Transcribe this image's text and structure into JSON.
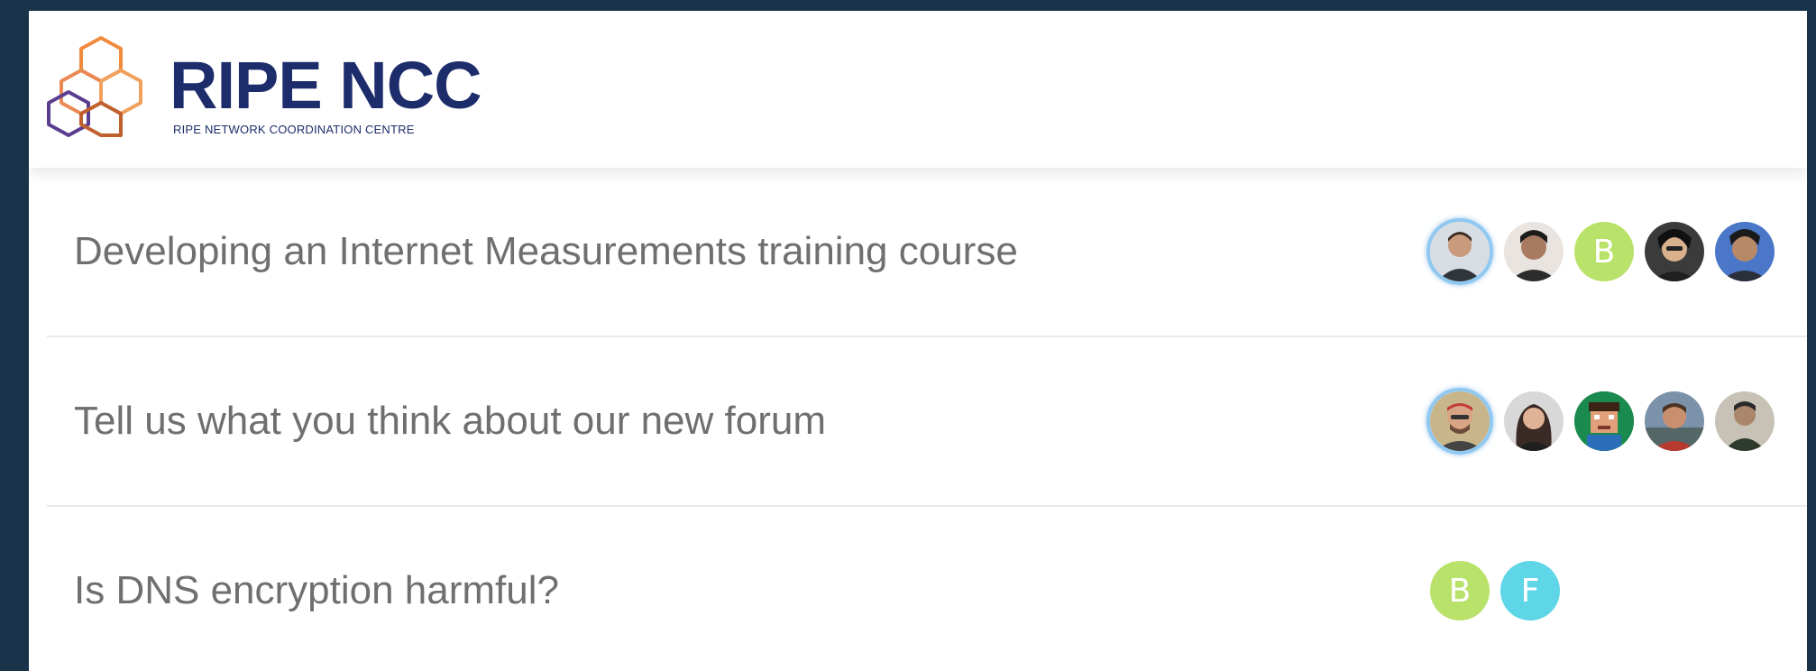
{
  "brand": {
    "name": "RIPE NCC",
    "subtitle": "RIPE NETWORK COORDINATION CENTRE",
    "colors": {
      "navy": "#1d2c6b",
      "orange": "#f08a3c",
      "purple": "#5b3d8f"
    }
  },
  "topics": [
    {
      "title": "Developing an Internet Measurements training course",
      "participants": [
        {
          "icon": "user-avatar",
          "letter": ""
        },
        {
          "icon": "user-avatar",
          "letter": ""
        },
        {
          "icon": "letter-avatar",
          "letter": "B",
          "color": "#b9e26a"
        },
        {
          "icon": "user-avatar",
          "letter": ""
        },
        {
          "icon": "user-avatar",
          "letter": ""
        }
      ]
    },
    {
      "title": "Tell us what you think about our new forum",
      "participants": [
        {
          "icon": "user-avatar",
          "letter": ""
        },
        {
          "icon": "user-avatar",
          "letter": ""
        },
        {
          "icon": "user-avatar",
          "letter": ""
        },
        {
          "icon": "user-avatar",
          "letter": ""
        },
        {
          "icon": "user-avatar",
          "letter": ""
        }
      ]
    },
    {
      "title": "Is DNS encryption harmful?",
      "participants": [
        {
          "icon": "letter-avatar",
          "letter": "B",
          "color": "#b9e26a"
        },
        {
          "icon": "letter-avatar",
          "letter": "F",
          "color": "#5fd6e8"
        }
      ]
    }
  ]
}
